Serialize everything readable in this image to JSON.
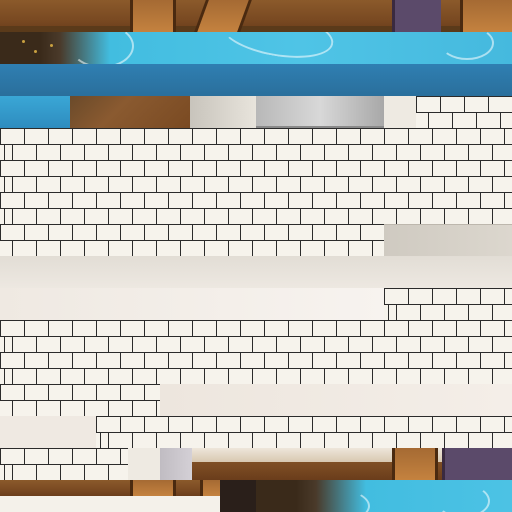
{
  "scene": {
    "kind": "tileset-texture",
    "colors": {
      "brick_face": "#f6f3ec",
      "brick_mortar": "#2b2b2b",
      "water": "#4fc4e6",
      "deep_water": "#2f7fb2",
      "wood": "#7a4a22",
      "panel_light": "#f1ebe3",
      "panel_grey": "#d6d2c9"
    }
  }
}
